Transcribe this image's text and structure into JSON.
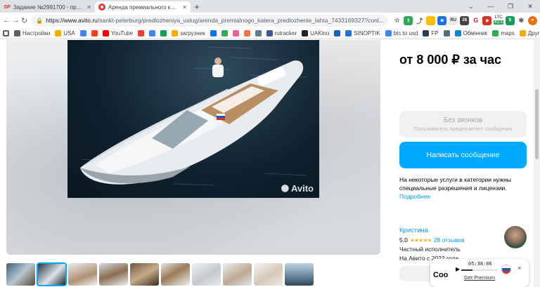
{
  "browser": {
    "tabs": [
      {
        "favicon": "SP",
        "title": "Задание №2991700 - просмотр з",
        "active": false
      },
      {
        "favicon": "avito-icon",
        "title": "Аренда премиального катера, П",
        "active": true
      }
    ],
    "new_tab": "+",
    "url_host": "https://www.avito.ru",
    "url_path": "/sankt-peterburg/predlozheniya_uslug/arenda_premialnogo_katera_predlozhenie_lahta_7433169327?cont...",
    "ext_ltc": {
      "label": "LTC",
      "value": "41.5"
    },
    "bookmarks": [
      {
        "label": "Настройки",
        "icon": "gear-icon"
      },
      {
        "label": "USA",
        "icon": "folder-icon"
      },
      {
        "label": "",
        "icon": "google-icon"
      },
      {
        "label": "",
        "icon": "yandex-icon"
      },
      {
        "label": "YouTube",
        "icon": "youtube-icon"
      },
      {
        "label": "",
        "icon": "gmail-icon"
      },
      {
        "label": "",
        "icon": "google-icon"
      },
      {
        "label": "",
        "icon": "drive-icon"
      },
      {
        "label": "загрузник",
        "icon": "folder-icon"
      },
      {
        "label": "",
        "icon": "vk-icon"
      },
      {
        "label": "",
        "icon": "maps-icon"
      },
      {
        "label": "",
        "icon": "f-icon"
      },
      {
        "label": "",
        "icon": "photo-icon"
      },
      {
        "label": "",
        "icon": "puzzle-icon"
      },
      {
        "label": "rutracker",
        "icon": "rutracker-icon"
      },
      {
        "label": "UAKino",
        "icon": "uakino-icon"
      },
      {
        "label": "",
        "icon": "bolt-icon"
      },
      {
        "label": "SINOPTIK",
        "icon": "weather-icon"
      },
      {
        "label": "btc to usd",
        "icon": "google-icon"
      },
      {
        "label": "FP",
        "icon": "fp-icon"
      },
      {
        "label": "",
        "icon": "eye-icon"
      },
      {
        "label": "Обмінник",
        "icon": "exchange-icon"
      },
      {
        "label": "maps",
        "icon": "maps-icon"
      }
    ],
    "other_bookmarks": "Другие закладки"
  },
  "listing": {
    "watermark": "Avito",
    "price": "от 8 000 ₽ за час",
    "no_calls_title": "Без звонков",
    "no_calls_sub": "Пользователь предпочитает сообщения",
    "write_message": "Написать сообщение",
    "notice": "На некоторые услуги в категории нужны специальные разрешения и лицензии.",
    "notice_more": "Подробнее",
    "seller": {
      "name": "Кристина",
      "rating": "5,0",
      "stars": "★★★★★",
      "reviews": "28 отзывов",
      "type": "Частный исполнитель",
      "since": "На Авито с 2022 года"
    },
    "thumbnail_count": 10
  },
  "premium_widget": {
    "timer": "05:38:06",
    "get_premium": "Get Premium",
    "close": "×",
    "left_label": "Соо",
    "flag": "russia-flag"
  }
}
